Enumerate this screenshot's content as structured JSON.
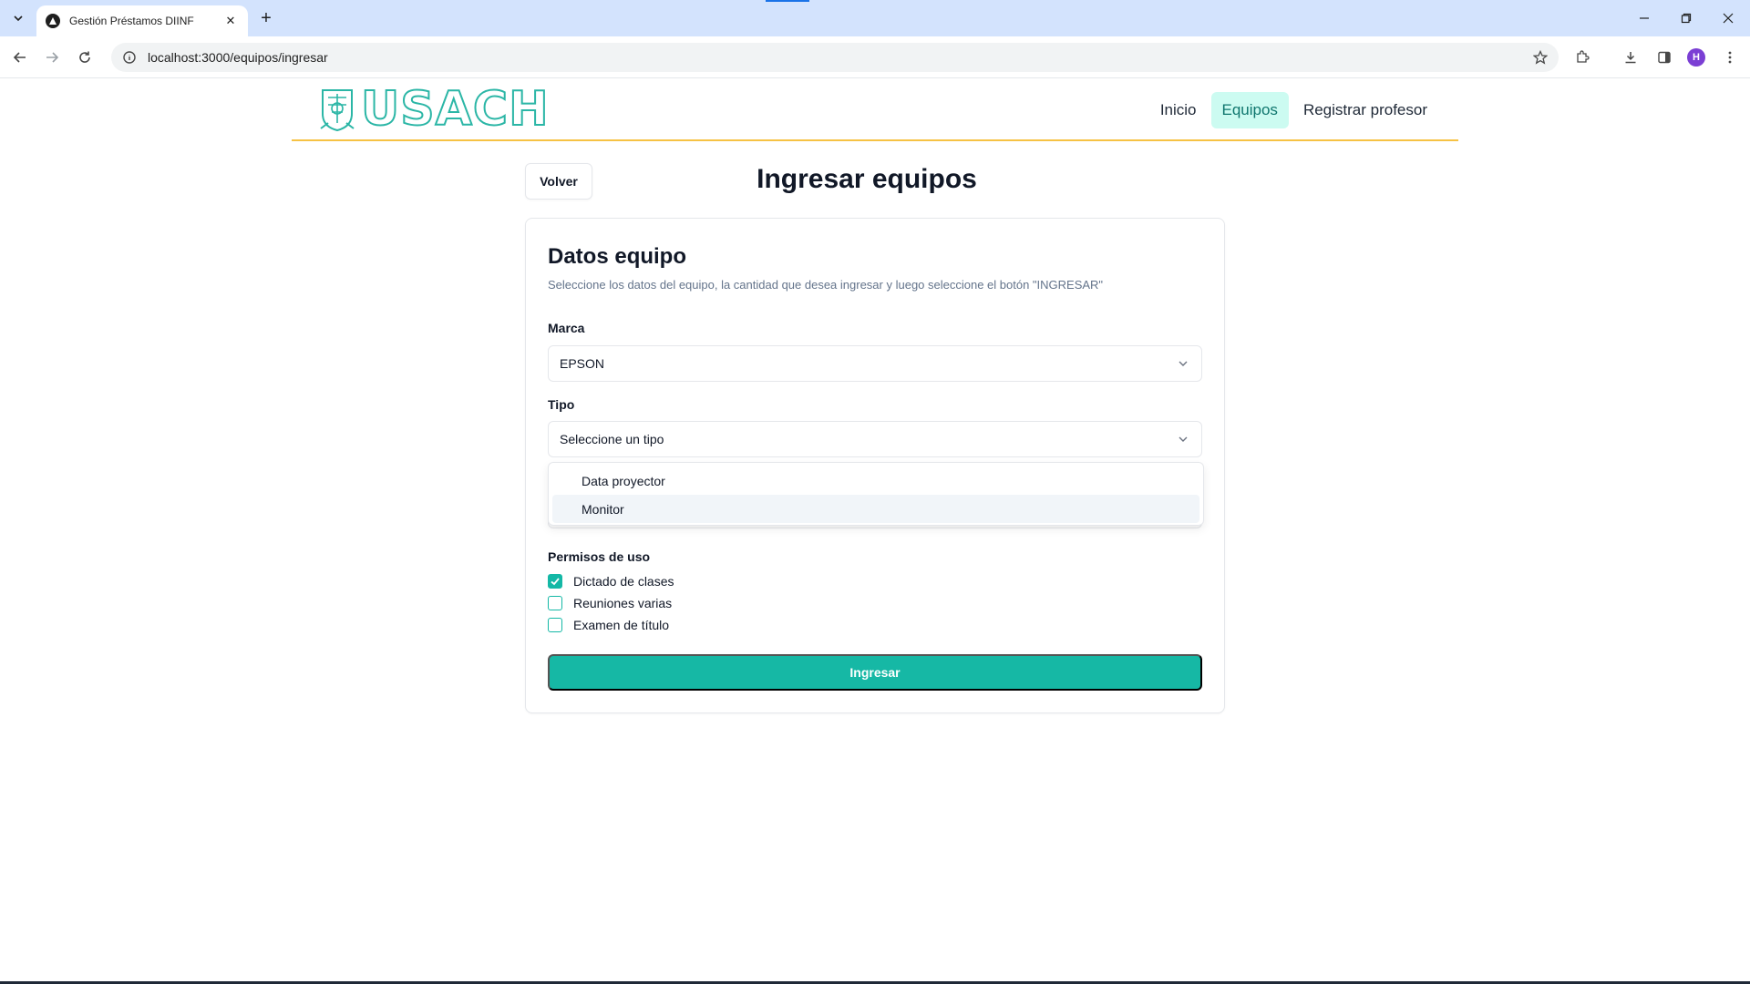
{
  "browser": {
    "tab_title": "Gestión Préstamos DIINF",
    "url": "localhost:3000/equipos/ingresar",
    "profile_initial": "H"
  },
  "navbar": {
    "logo_text": "USACH",
    "links": [
      {
        "label": "Inicio",
        "active": false
      },
      {
        "label": "Equipos",
        "active": true
      },
      {
        "label": "Registrar profesor",
        "active": false
      }
    ]
  },
  "page": {
    "back_label": "Volver",
    "title": "Ingresar equipos"
  },
  "card": {
    "title": "Datos equipo",
    "description": "Seleccione los datos del equipo, la cantidad que desea ingresar y luego seleccione el botón \"INGRESAR\"",
    "marca": {
      "label": "Marca",
      "value": "EPSON"
    },
    "tipo": {
      "label": "Tipo",
      "value": "Seleccione un tipo",
      "options": [
        "Data proyector",
        "Monitor"
      ],
      "highlighted": "Monitor"
    },
    "permisos": {
      "label": "Permisos de uso",
      "options": [
        {
          "label": "Dictado de clases",
          "checked": true
        },
        {
          "label": "Reuniones varias",
          "checked": false
        },
        {
          "label": "Examen de título",
          "checked": false
        }
      ]
    },
    "submit_label": "Ingresar"
  },
  "colors": {
    "accent": "#16b8a5",
    "nav_active_bg": "#ccfbf1",
    "divider": "#f6c244"
  }
}
